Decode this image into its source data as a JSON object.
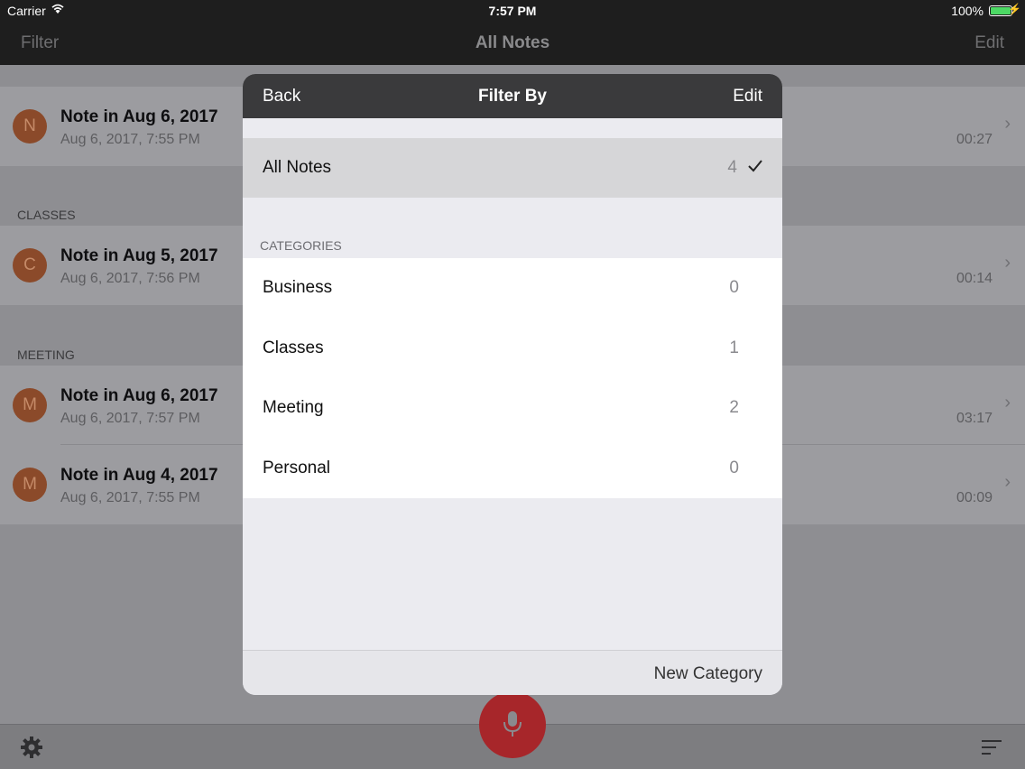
{
  "status_bar": {
    "carrier": "Carrier",
    "time": "7:57 PM",
    "battery": "100%"
  },
  "nav": {
    "left": "Filter",
    "title": "All Notes",
    "right": "Edit"
  },
  "notes": {
    "ungrouped": [
      {
        "initial": "N",
        "title": "Note in Aug 6, 2017",
        "date": "Aug 6, 2017, 7:55 PM",
        "duration": "00:27"
      }
    ],
    "classes_header": "CLASSES",
    "classes": [
      {
        "initial": "C",
        "title": "Note in Aug 5, 2017",
        "date": "Aug 6, 2017, 7:56 PM",
        "duration": "00:14"
      }
    ],
    "meeting_header": "MEETING",
    "meeting": [
      {
        "initial": "M",
        "title": "Note in Aug 6, 2017",
        "date": "Aug 6, 2017, 7:57 PM",
        "duration": "03:17"
      },
      {
        "initial": "M",
        "title": "Note in Aug 4, 2017",
        "date": "Aug 6, 2017, 7:55 PM",
        "duration": "00:09"
      }
    ]
  },
  "modal": {
    "back": "Back",
    "title": "Filter By",
    "edit": "Edit",
    "all_notes": {
      "label": "All Notes",
      "count": "4"
    },
    "categories_header": "CATEGORIES",
    "categories": [
      {
        "label": "Business",
        "count": "0"
      },
      {
        "label": "Classes",
        "count": "1"
      },
      {
        "label": "Meeting",
        "count": "2"
      },
      {
        "label": "Personal",
        "count": "0"
      }
    ],
    "new_category": "New Category"
  },
  "icons": {
    "settings": "gear-icon",
    "record": "microphone-icon",
    "sort": "sort-icon"
  },
  "colors": {
    "record_button": "#a7262a",
    "avatar": "#8b4a2a",
    "battery": "#4cd964"
  }
}
